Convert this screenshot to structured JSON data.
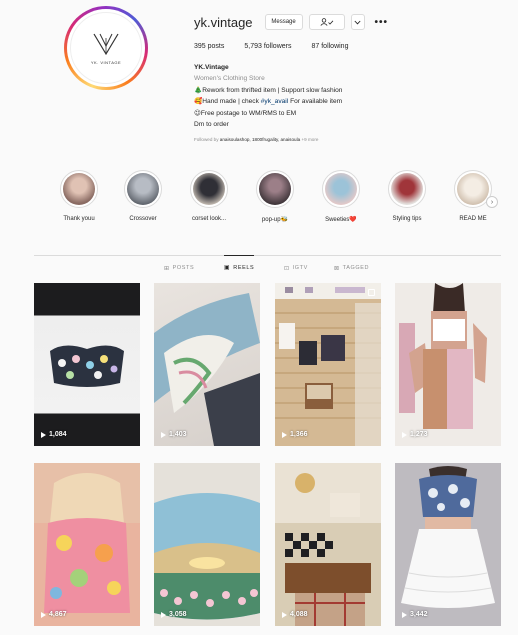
{
  "profile": {
    "username": "yk.vintage",
    "logo_text": "YK. VINTAGE",
    "buttons": {
      "message": "Message"
    },
    "more": "•••",
    "stats": {
      "posts": "395",
      "posts_label": "posts",
      "followers": "5,793",
      "followers_label": "followers",
      "following": "87",
      "following_label": "following"
    },
    "bio": {
      "name": "YK.Vintage",
      "category": "Women's Clothing Store",
      "line1": "🎄Rework from thrifted item | Support slow fashion",
      "line2_pre": "🥰Hand made | check ",
      "line2_tag": "#yk_avail",
      "line2_post": " For available item",
      "line3": "😉Free postage to WM/RMS to EM",
      "line4": "Dm to order"
    },
    "followed_by_pre": "Followed by ",
    "followed_by_users": "anaisoulashop, 1800frugality, anaisoula",
    "followed_by_more": " +9 more"
  },
  "highlights": [
    {
      "label": "Thank youu",
      "color": "#c9a99a"
    },
    {
      "label": "Crossover",
      "color": "#8a8f97"
    },
    {
      "label": "corset look...",
      "color": "#4a4a52"
    },
    {
      "label": "pop-up🐝",
      "color": "#6b5b63"
    },
    {
      "label": "Sweeties❤️",
      "color": "#9cc3d8"
    },
    {
      "label": "Styling tips",
      "color": "#a0353a"
    },
    {
      "label": "READ ME",
      "color": "#e9dfd2"
    }
  ],
  "highlights_next": "›",
  "tabs": [
    {
      "label": "POSTS",
      "icon": "⊞",
      "active": false
    },
    {
      "label": "REELS",
      "icon": "▣",
      "active": true
    },
    {
      "label": "IGTV",
      "icon": "⊡",
      "active": false
    },
    {
      "label": "TAGGED",
      "icon": "⊠",
      "active": false
    }
  ],
  "reels": [
    {
      "views": "1,084",
      "bg": "#2a2d36"
    },
    {
      "views": "1,403",
      "bg": "#5f7c8a"
    },
    {
      "views": "1,366",
      "bg": "#c9b39a"
    },
    {
      "views": "1,273",
      "bg": "#d9b8b3"
    },
    {
      "views": "4,867",
      "bg": "#d98a7e"
    },
    {
      "views": "3,058",
      "bg": "#7ea9bc"
    },
    {
      "views": "4,088",
      "bg": "#8c6e55"
    },
    {
      "views": "3,442",
      "bg": "#c9c6c9"
    }
  ]
}
